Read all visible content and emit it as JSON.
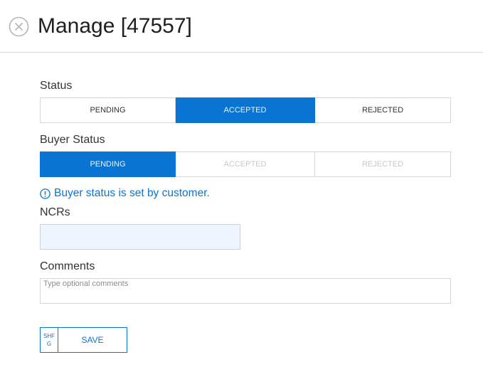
{
  "header": {
    "title": "Manage [47557]",
    "close_icon": "close-circle-icon"
  },
  "status": {
    "label": "Status",
    "options": [
      "PENDING",
      "ACCEPTED",
      "REJECTED"
    ],
    "selected": "ACCEPTED"
  },
  "buyer_status": {
    "label": "Buyer Status",
    "options": [
      "PENDING",
      "ACCEPTED",
      "REJECTED"
    ],
    "selected": "PENDING",
    "info_icon": "info-circle-icon",
    "info_text": "Buyer status is set by customer."
  },
  "ncrs": {
    "label": "NCRs",
    "value": ""
  },
  "comments": {
    "label": "Comments",
    "placeholder": "Type optional comments",
    "value": ""
  },
  "actions": {
    "shfg_label": "SHFG",
    "save_label": "SAVE"
  },
  "colors": {
    "accent": "#0a74d2",
    "input_bg": "#eef5fe",
    "border": "#d6d6d6"
  }
}
